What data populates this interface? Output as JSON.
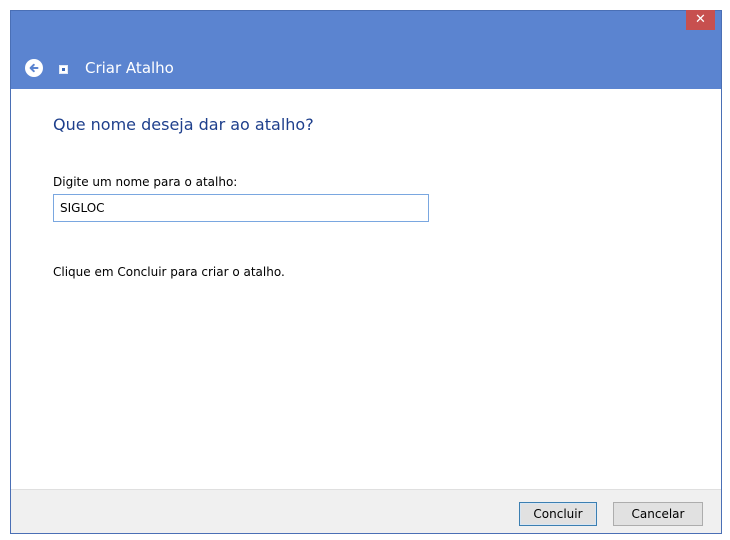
{
  "window": {
    "title": "Criar Atalho",
    "close_symbol": "✕"
  },
  "main": {
    "heading": "Que nome deseja dar ao atalho?",
    "name_label": "Digite um nome para o atalho:",
    "name_value": "SIGLOC",
    "hint": "Clique em Concluir para criar o atalho."
  },
  "footer": {
    "finish_label": "Concluir",
    "cancel_label": "Cancelar"
  },
  "icons": {
    "back": "back-arrow-icon",
    "wizard": "shortcut-wizard-icon",
    "close": "close-icon"
  },
  "colors": {
    "titlebar": "#5b84d0",
    "close_button": "#c7504f",
    "heading": "#1e3f8c",
    "input_border": "#7aa7e0"
  }
}
